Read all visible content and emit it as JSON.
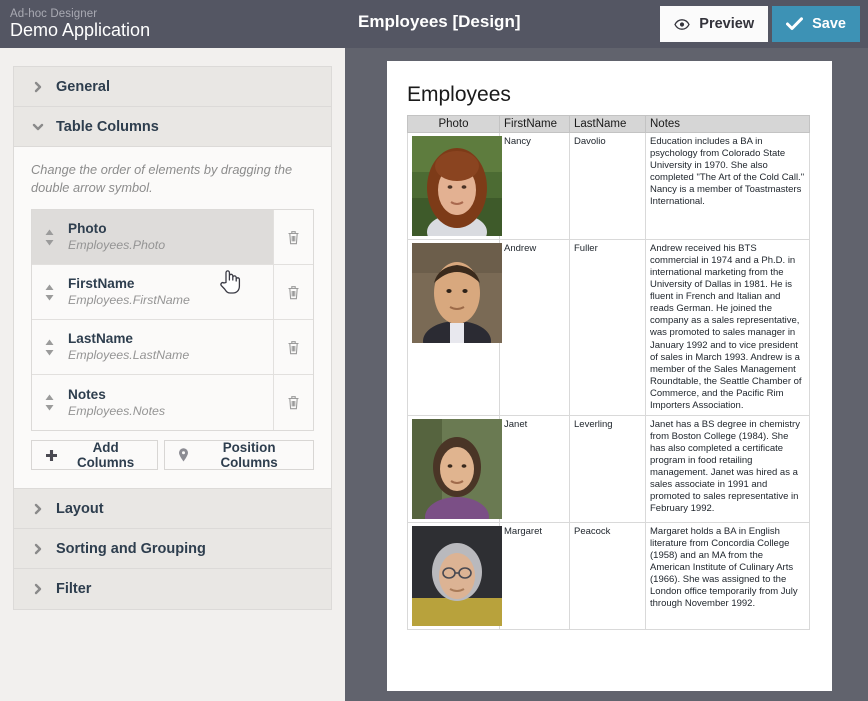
{
  "topbar": {
    "brand_sub": "Ad-hoc Designer",
    "brand_title": "Demo Application",
    "doc_title": "Employees [Design]",
    "preview_label": "Preview",
    "save_label": "Save",
    "preview_icon": "eye-icon",
    "save_icon": "check-icon",
    "bg_color": "#545663",
    "save_color": "#3d92b5"
  },
  "sidebar": {
    "sections": [
      {
        "label": "General",
        "expanded": false
      },
      {
        "label": "Table Columns",
        "expanded": true
      },
      {
        "label": "Layout",
        "expanded": false
      },
      {
        "label": "Sorting and Grouping",
        "expanded": false
      },
      {
        "label": "Filter",
        "expanded": false
      }
    ],
    "table_columns": {
      "hint": "Change the order of elements by dragging the double arrow symbol.",
      "items": [
        {
          "name": "Photo",
          "path": "Employees.Photo",
          "active": true
        },
        {
          "name": "FirstName",
          "path": "Employees.FirstName",
          "active": false
        },
        {
          "name": "LastName",
          "path": "Employees.LastName",
          "active": false
        },
        {
          "name": "Notes",
          "path": "Employees.Notes",
          "active": false
        }
      ],
      "add_label": "Add Columns",
      "position_label": "Position Columns",
      "add_icon": "plus-icon",
      "position_icon": "map-pin-icon",
      "drag_icon": "updown-arrow-icon",
      "delete_icon": "trash-icon"
    }
  },
  "preview": {
    "title": "Employees",
    "columns": [
      "Photo",
      "FirstName",
      "LastName",
      "Notes"
    ],
    "rows": [
      {
        "photo": "employee-photo-nancy",
        "first": "Nancy",
        "last": "Davolio",
        "notes": "Education includes a BA in psychology from Colorado State University in 1970. She also completed \"The Art of the Cold Call.\" Nancy is a member of Toastmasters International."
      },
      {
        "photo": "employee-photo-andrew",
        "first": "Andrew",
        "last": "Fuller",
        "notes": "Andrew received his BTS commercial in 1974 and a Ph.D. in international marketing from the University of Dallas in 1981. He is fluent in French and Italian and reads German. He joined the company as a sales representative, was promoted to sales manager in January 1992 and to vice president of sales in March 1993. Andrew is a member of the Sales Management Roundtable, the Seattle Chamber of Commerce, and the Pacific Rim Importers Association."
      },
      {
        "photo": "employee-photo-janet",
        "first": "Janet",
        "last": "Leverling",
        "notes": "Janet has a BS degree in chemistry from Boston College (1984). She has also completed a certificate program in food retailing management. Janet was hired as a sales associate in 1991 and promoted to sales representative in February 1992."
      },
      {
        "photo": "employee-photo-margaret",
        "first": "Margaret",
        "last": "Peacock",
        "notes": "Margaret holds a BA in English literature from Concordia College (1958) and an MA from the American Institute of Culinary Arts (1966). She was assigned to the London office temporarily from July through November 1992."
      }
    ]
  },
  "cursor": {
    "icon": "hand-pointer-cursor"
  }
}
